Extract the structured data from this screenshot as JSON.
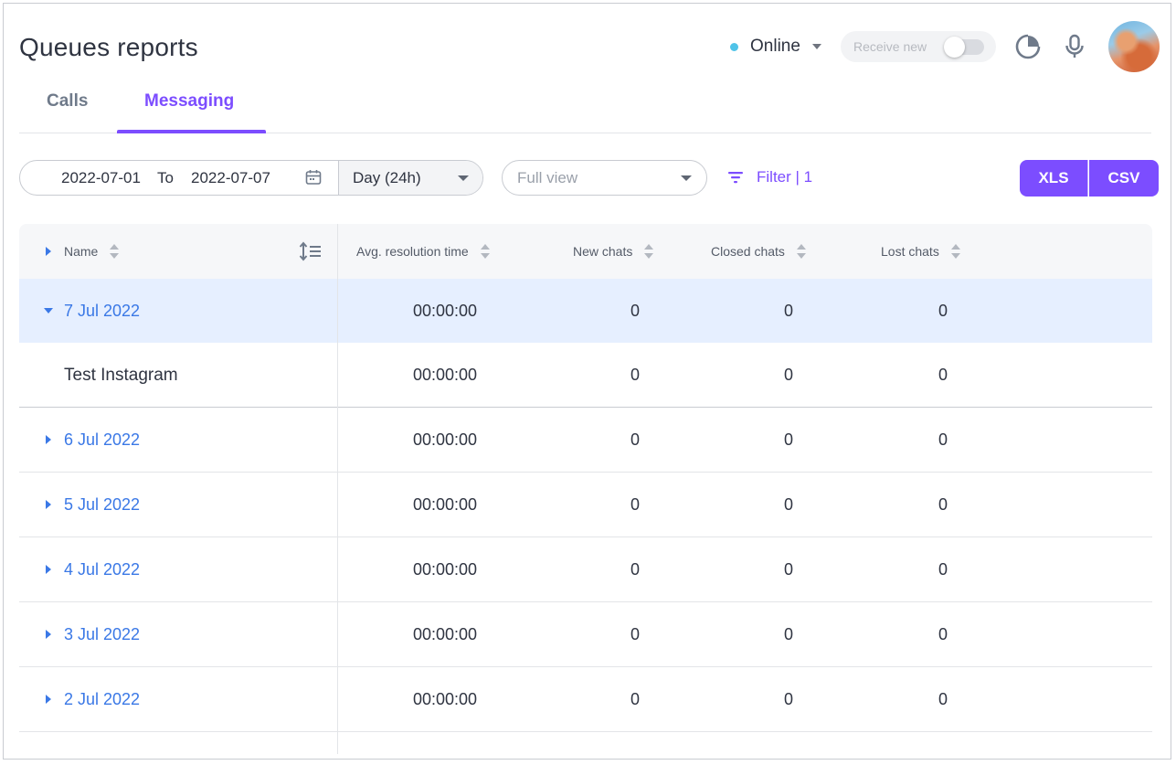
{
  "header": {
    "title": "Queues reports",
    "status": "Online",
    "receive_label": "Receive new",
    "status_color": "#4fc3e8"
  },
  "tabs": [
    {
      "label": "Calls",
      "active": false
    },
    {
      "label": "Messaging",
      "active": true
    }
  ],
  "toolbar": {
    "date_from": "2022-07-01",
    "to_label": "To",
    "date_to": "2022-07-07",
    "period": "Day (24h)",
    "view_placeholder": "Full view",
    "filter_label": "Filter | 1",
    "xls_label": "XLS",
    "csv_label": "CSV",
    "accent": "#7c4dff"
  },
  "table": {
    "columns": [
      "Name",
      "Avg. resolution time",
      "New chats",
      "Closed chats",
      "Lost chats"
    ],
    "rows": [
      {
        "name": "7 Jul 2022",
        "avg": "00:00:00",
        "new": "0",
        "closed": "0",
        "lost": "0",
        "expanded": true
      },
      {
        "name": "Test Instagram",
        "avg": "00:00:00",
        "new": "0",
        "closed": "0",
        "lost": "0",
        "child": true
      },
      {
        "name": "6 Jul 2022",
        "avg": "00:00:00",
        "new": "0",
        "closed": "0",
        "lost": "0"
      },
      {
        "name": "5 Jul 2022",
        "avg": "00:00:00",
        "new": "0",
        "closed": "0",
        "lost": "0"
      },
      {
        "name": "4 Jul 2022",
        "avg": "00:00:00",
        "new": "0",
        "closed": "0",
        "lost": "0"
      },
      {
        "name": "3 Jul 2022",
        "avg": "00:00:00",
        "new": "0",
        "closed": "0",
        "lost": "0"
      },
      {
        "name": "2 Jul 2022",
        "avg": "00:00:00",
        "new": "0",
        "closed": "0",
        "lost": "0"
      }
    ]
  }
}
